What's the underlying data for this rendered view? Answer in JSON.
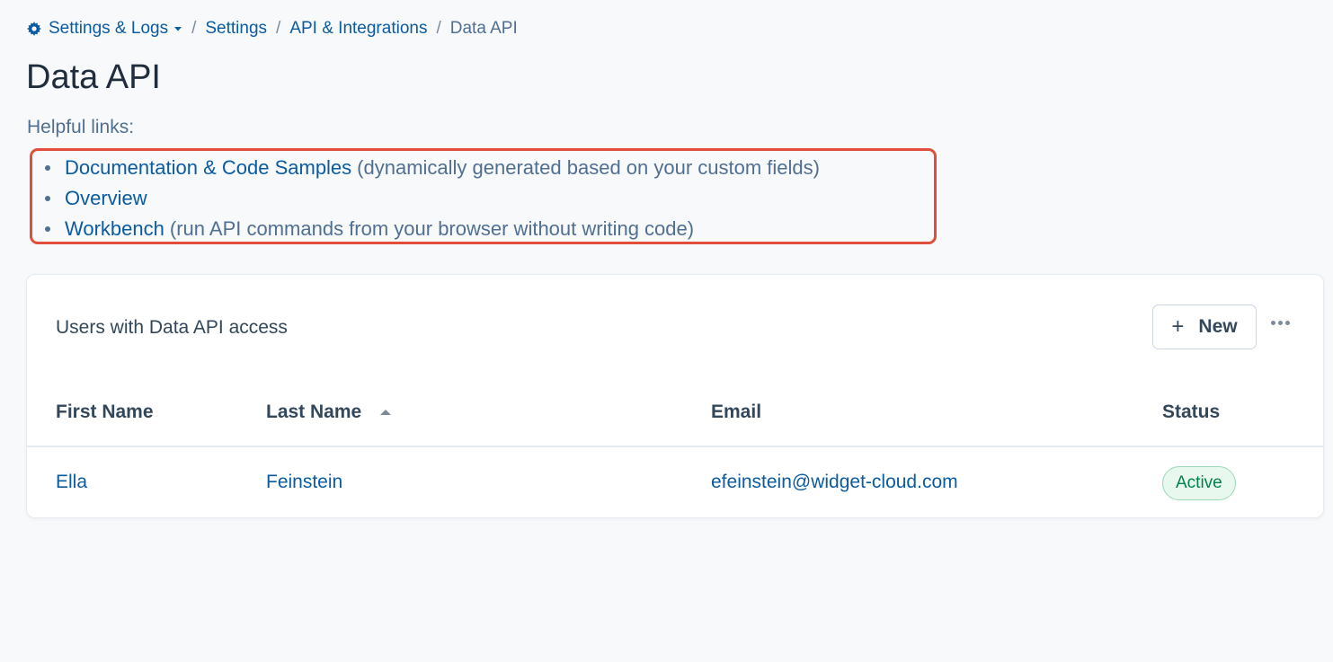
{
  "breadcrumb": {
    "root_label": "Settings & Logs",
    "separator": "/",
    "items": [
      "Settings",
      "API & Integrations"
    ],
    "current": "Data API"
  },
  "page_title": "Data API",
  "helpful": {
    "label": "Helpful links:",
    "links": [
      {
        "label": "Documentation & Code Samples",
        "description": "(dynamically generated based on your custom fields)"
      },
      {
        "label": "Overview",
        "description": ""
      },
      {
        "label": "Workbench",
        "description": "(run API commands from your browser without writing code)"
      }
    ]
  },
  "card": {
    "title": "Users with Data API access",
    "new_button_label": "New",
    "columns": [
      "First Name",
      "Last Name",
      "Email",
      "Status"
    ],
    "rows": [
      {
        "first_name": "Ella",
        "last_name": "Feinstein",
        "email": "efeinstein@widget-cloud.com",
        "status": "Active"
      }
    ]
  },
  "icons": {
    "gear": "gear-icon",
    "caret": "caret-down-icon",
    "plus": "plus-icon",
    "more": "more-horizontal-icon",
    "sort": "sort-ascending-icon"
  },
  "colors": {
    "link": "#0b5ba1",
    "highlight_border": "#e14f3c",
    "status_active_text": "#00824a",
    "status_active_bg": "#e8f8ef"
  }
}
